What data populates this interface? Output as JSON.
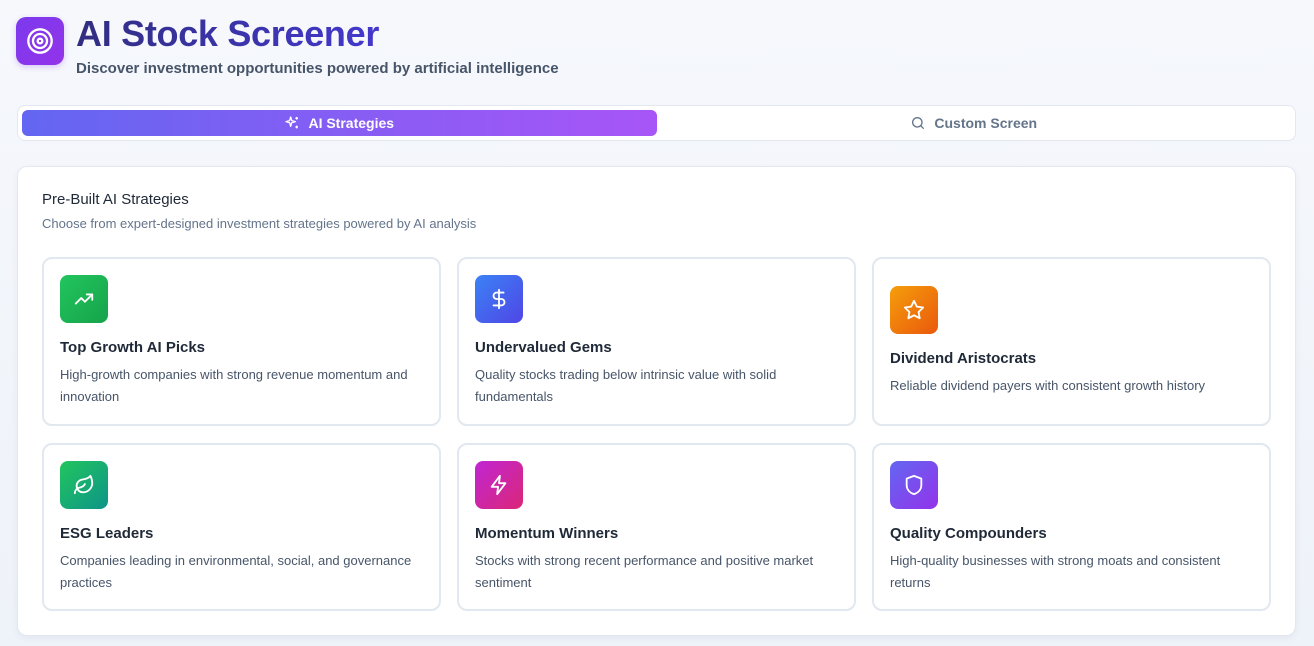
{
  "header": {
    "title": "AI Stock Screener",
    "subtitle": "Discover investment opportunities powered by artificial intelligence",
    "logo_icon": "target-icon"
  },
  "tabs": [
    {
      "label": "AI Strategies",
      "icon": "sparkles-icon",
      "active": true
    },
    {
      "label": "Custom Screen",
      "icon": "search-icon",
      "active": false
    }
  ],
  "panel": {
    "title": "Pre-Built AI Strategies",
    "description": "Choose from expert-designed investment strategies powered by AI analysis",
    "cards": [
      {
        "title": "Top Growth AI Picks",
        "description": "High-growth companies with strong revenue momentum and innovation",
        "icon": "trending-up-icon",
        "color": "#16a34a"
      },
      {
        "title": "Undervalued Gems",
        "description": "Quality stocks trading below intrinsic value with solid fundamentals",
        "icon": "dollar-sign-icon",
        "color": "#4f46e5"
      },
      {
        "title": "Dividend Aristocrats",
        "description": "Reliable dividend payers with consistent growth history",
        "icon": "star-icon",
        "color": "#ea580c"
      },
      {
        "title": "ESG Leaders",
        "description": "Companies leading in environmental, social, and governance practices",
        "icon": "leaf-icon",
        "color": "#0d9488"
      },
      {
        "title": "Momentum Winners",
        "description": "Stocks with strong recent performance and positive market sentiment",
        "icon": "lightning-icon",
        "color": "#db2777"
      },
      {
        "title": "Quality Compounders",
        "description": "High-quality businesses with strong moats and consistent returns",
        "icon": "shield-icon",
        "color": "#9333ea"
      }
    ]
  }
}
